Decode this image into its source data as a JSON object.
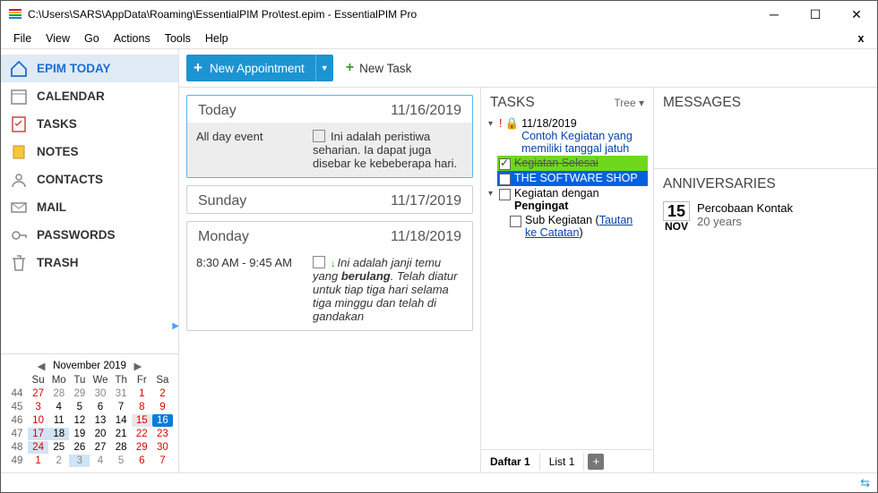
{
  "window": {
    "title": "C:\\Users\\SARS\\AppData\\Roaming\\EssentialPIM Pro\\test.epim - EssentialPIM Pro"
  },
  "menu": [
    "File",
    "View",
    "Go",
    "Actions",
    "Tools",
    "Help"
  ],
  "sidebar": [
    "EPIM TODAY",
    "CALENDAR",
    "TASKS",
    "NOTES",
    "CONTACTS",
    "MAIL",
    "PASSWORDS",
    "TRASH"
  ],
  "toolbar": {
    "newAppointment": "New Appointment",
    "newTask": "New Task"
  },
  "miniCal": {
    "title": "November  2019",
    "dayHeaders": [
      "Su",
      "Mo",
      "Tu",
      "We",
      "Th",
      "Fr",
      "Sa"
    ],
    "weeks": [
      {
        "wk": 44,
        "days": [
          [
            27,
            "off we"
          ],
          [
            28,
            "off"
          ],
          [
            29,
            "off"
          ],
          [
            30,
            "off"
          ],
          [
            31,
            "off"
          ],
          [
            1,
            "we"
          ],
          [
            2,
            "we"
          ]
        ]
      },
      {
        "wk": 45,
        "days": [
          [
            3,
            "we"
          ],
          [
            4,
            ""
          ],
          [
            5,
            ""
          ],
          [
            6,
            ""
          ],
          [
            7,
            ""
          ],
          [
            8,
            "we"
          ],
          [
            9,
            "we"
          ]
        ]
      },
      {
        "wk": 46,
        "days": [
          [
            10,
            "we"
          ],
          [
            11,
            ""
          ],
          [
            12,
            ""
          ],
          [
            13,
            ""
          ],
          [
            14,
            ""
          ],
          [
            15,
            "we sel"
          ],
          [
            16,
            "today"
          ]
        ]
      },
      {
        "wk": 47,
        "days": [
          [
            17,
            "we hl"
          ],
          [
            18,
            "hl"
          ],
          [
            19,
            ""
          ],
          [
            20,
            ""
          ],
          [
            21,
            ""
          ],
          [
            22,
            "we"
          ],
          [
            23,
            "we"
          ]
        ]
      },
      {
        "wk": 48,
        "days": [
          [
            24,
            "we hl"
          ],
          [
            25,
            ""
          ],
          [
            26,
            ""
          ],
          [
            27,
            ""
          ],
          [
            28,
            ""
          ],
          [
            29,
            "we"
          ],
          [
            30,
            "we"
          ]
        ]
      },
      {
        "wk": 49,
        "days": [
          [
            1,
            "off we"
          ],
          [
            2,
            "off"
          ],
          [
            3,
            "off hl"
          ],
          [
            4,
            "off"
          ],
          [
            5,
            "off"
          ],
          [
            6,
            "off we"
          ],
          [
            7,
            "off we"
          ]
        ]
      }
    ]
  },
  "today": {
    "days": [
      {
        "label": "Today",
        "date": "11/16/2019",
        "events": [
          {
            "time": "All day event",
            "text": "Ini adalah peristiwa seharian. Ia dapat juga disebar ke kebeberapa hari."
          }
        ]
      },
      {
        "label": "Sunday",
        "date": "11/17/2019",
        "events": []
      },
      {
        "label": "Monday",
        "date": "11/18/2019",
        "events": [
          {
            "time": "8:30 AM - 9:45 AM",
            "text1": "Ini adalah janji temu yang",
            "bold": "berulang",
            "text2": ". Telah diatur untuk tiap tiga hari selama tiga minggu dan telah di gandakan"
          }
        ]
      }
    ]
  },
  "tasks": {
    "title": "TASKS",
    "viewMode": "Tree",
    "items": [
      {
        "date": "11/18/2019",
        "text": "Contoh Kegiatan yang memiliki tanggal jatuh"
      },
      {
        "text": "Kegiatan Selesai"
      },
      {
        "text": "THE SOFTWARE SHOP"
      },
      {
        "text1": "Kegiatan dengan",
        "bold": "Pengingat"
      },
      {
        "text": "Sub Kegiatan",
        "link": "Tautan ke Catatan"
      }
    ],
    "tabs": [
      "Daftar 1",
      "List 1"
    ]
  },
  "messages": {
    "title": "MESSAGES"
  },
  "anniversaries": {
    "title": "ANNIVERSARIES",
    "items": [
      {
        "day": "15",
        "month": "NOV",
        "name": "Percobaan Kontak",
        "age": "20 years"
      }
    ]
  }
}
